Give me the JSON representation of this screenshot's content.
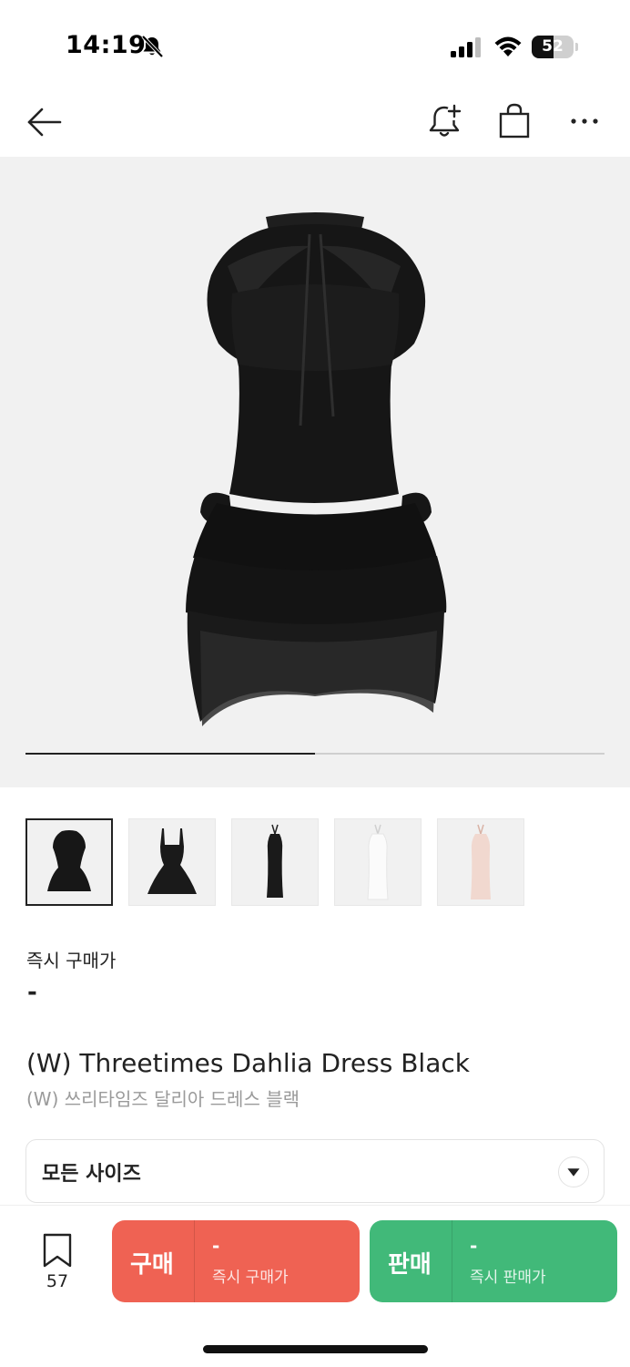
{
  "status_bar": {
    "time": "14:19",
    "battery_level": "52",
    "battery_fraction": 0.52,
    "icons": [
      "bell-off-icon",
      "cellular-signal-icon",
      "wifi-icon",
      "battery-icon"
    ]
  },
  "header": {
    "icons": [
      "back-arrow-icon",
      "bell-plus-icon",
      "shopping-bag-icon",
      "more-icon"
    ]
  },
  "gallery": {
    "progress_fraction": 0.5,
    "thumbnail_count": 5,
    "active_index": 0
  },
  "price": {
    "label": "즉시 구매가",
    "value": "-"
  },
  "product": {
    "title_en": "(W) Threetimes Dahlia Dress Black",
    "title_ko": "(W) 쓰리타임즈 달리아 드레스 블랙"
  },
  "size_select": {
    "label": "모든 사이즈"
  },
  "bottom_bar": {
    "wish_count": "57",
    "buy": {
      "label": "구매",
      "price": "-",
      "sub": "즉시 구매가"
    },
    "sell": {
      "label": "판매",
      "price": "-",
      "sub": "즉시 판매가"
    }
  },
  "colors": {
    "buy": "#ef6253",
    "sell": "#41b979",
    "hero_bg": "#f1f1f1"
  }
}
